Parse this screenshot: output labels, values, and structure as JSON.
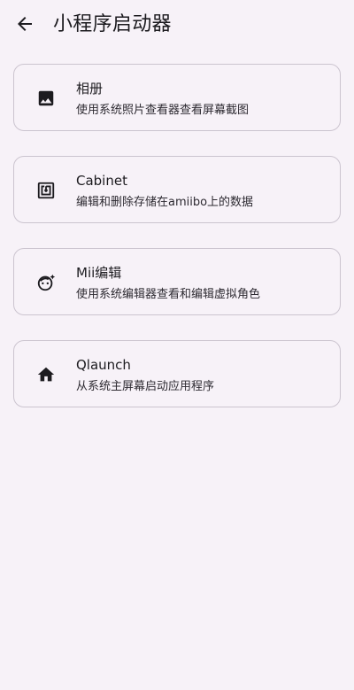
{
  "header": {
    "back_icon": "arrow-back-icon",
    "title": "小程序启动器"
  },
  "cards": [
    {
      "icon": "image-icon",
      "title": "相册",
      "description": "使用系统照片查看器查看屏幕截图"
    },
    {
      "icon": "nfc-icon",
      "title": "Cabinet",
      "description": "编辑和删除存储在amiibo上的数据"
    },
    {
      "icon": "face-edit-icon",
      "title": "Mii编辑",
      "description": "使用系统编辑器查看和编辑虚拟角色"
    },
    {
      "icon": "home-icon",
      "title": "Qlaunch",
      "description": "从系统主屏幕启动应用程序"
    }
  ],
  "colors": {
    "background": "#f7f2f8",
    "card_border": "#cbc4cf",
    "text": "#1c1b1f"
  }
}
